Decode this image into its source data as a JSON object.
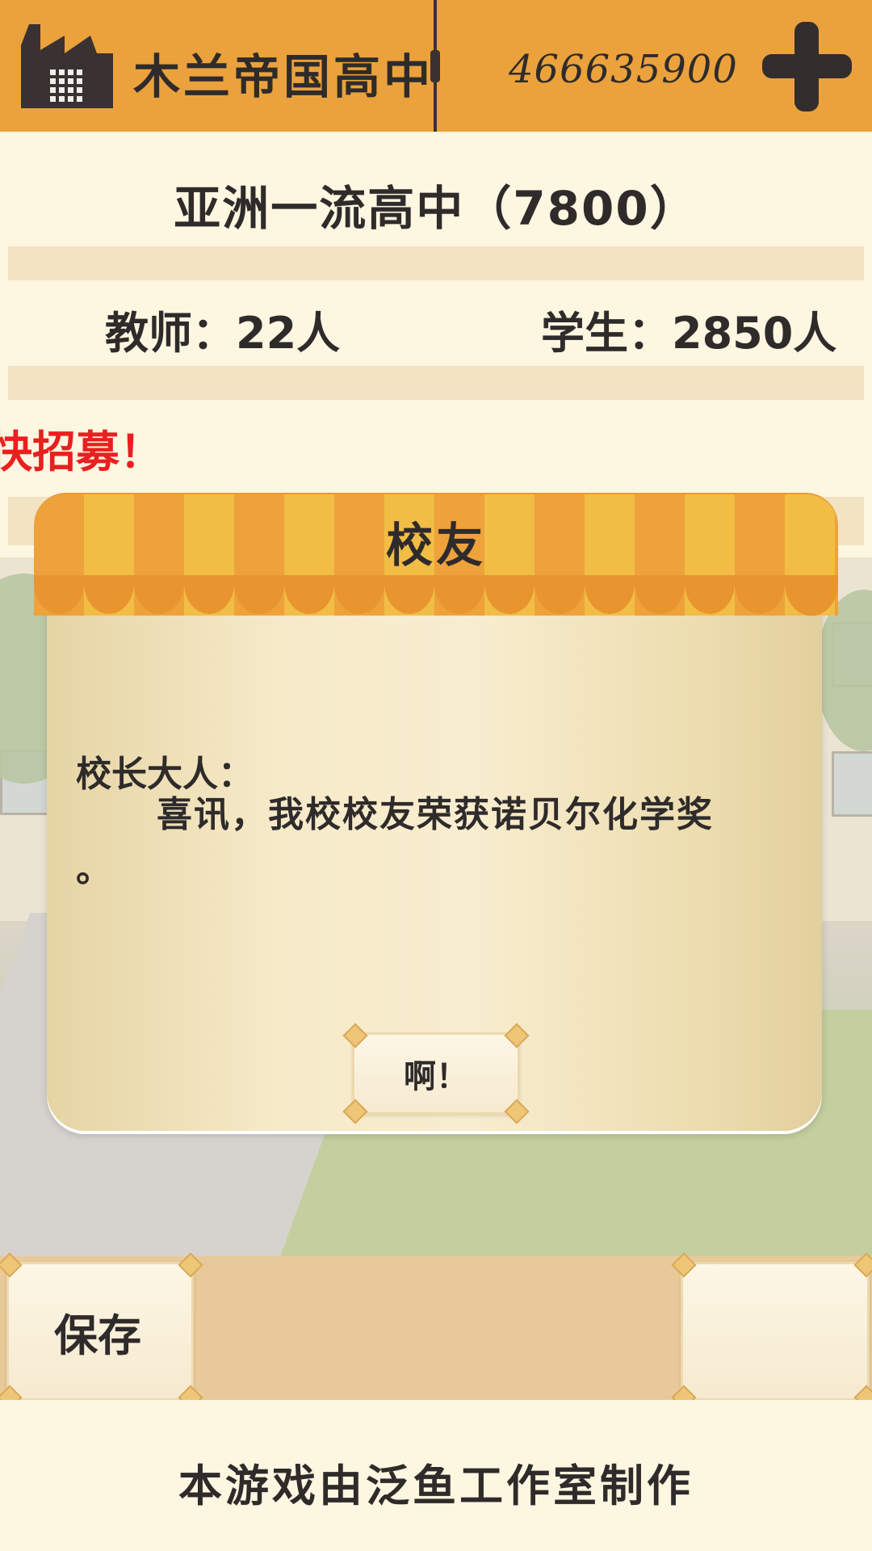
{
  "header": {
    "school_name": "木兰帝国高中",
    "money": "466635900",
    "school_icon": "factory-icon",
    "add_icon": "plus-icon"
  },
  "info": {
    "rank": "亚洲一流高中（7800）",
    "teachers": "教师：22人",
    "students": "学生：2850人",
    "recruit_notice": "快招募！"
  },
  "dialog": {
    "title": "校友",
    "salutation": "校长大人：",
    "body": "喜讯，我校校友荣获诺贝尔化学奖",
    "body_end": "。",
    "ok_label": "啊！"
  },
  "bottom": {
    "save_label": "保存",
    "credits": "本游戏由泛鱼工作室制作"
  },
  "colors": {
    "top_bar": "#eba23c",
    "panel": "#fdf6e1",
    "stripe": "#f2e3c3",
    "warning_text": "#ea1f1f",
    "awning_orange": "#eea23a",
    "awning_yellow": "#f2bd45",
    "bottom_bar": "#e8c99a",
    "text_dark": "#2f2b2b"
  }
}
